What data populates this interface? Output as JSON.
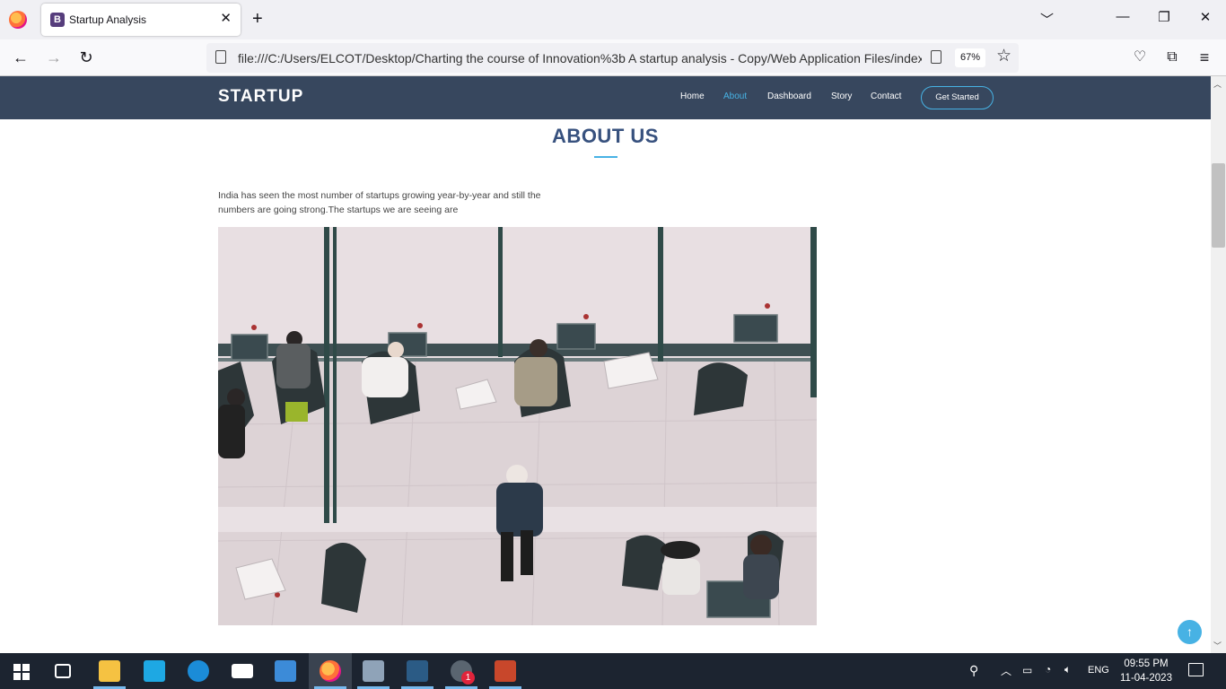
{
  "browser": {
    "tab_title": "Startup Analysis",
    "tab_favicon_letter": "B",
    "tab_close": "✕",
    "new_tab": "+",
    "url_main": "file:///C:/Users/ELCOT/Desktop/Charting the course of Innovation%3b A startup analysis - Copy/Web Application Files/index.",
    "url_fade": "h",
    "zoom": "67%"
  },
  "site": {
    "logo": "STARTUP",
    "nav": [
      {
        "label": "Home"
      },
      {
        "label": "About"
      },
      {
        "label": "Dashboard"
      },
      {
        "label": "Story"
      },
      {
        "label": "Contact"
      }
    ],
    "cta": "Get Started",
    "active_nav": "About",
    "accent_color": "#47b2e4",
    "header_color": "#37475e"
  },
  "about": {
    "title": "ABOUT US",
    "text": "India has seen the most number of startups growing year-by-year and still the numbers are going strong.The startups we are seeing are"
  },
  "taskbar": {
    "lang": "ENG",
    "time": "09:55 PM",
    "date": "11-04-2023",
    "badge": "1",
    "apps": [
      "start-icon",
      "task-view-icon",
      "file-explorer-icon",
      "migration-app-icon",
      "edge-icon",
      "mail-icon",
      "store-icon",
      "firefox-icon",
      "network-tool-icon",
      "code-app-icon",
      "whatsapp-icon",
      "powerpoint-icon"
    ]
  }
}
